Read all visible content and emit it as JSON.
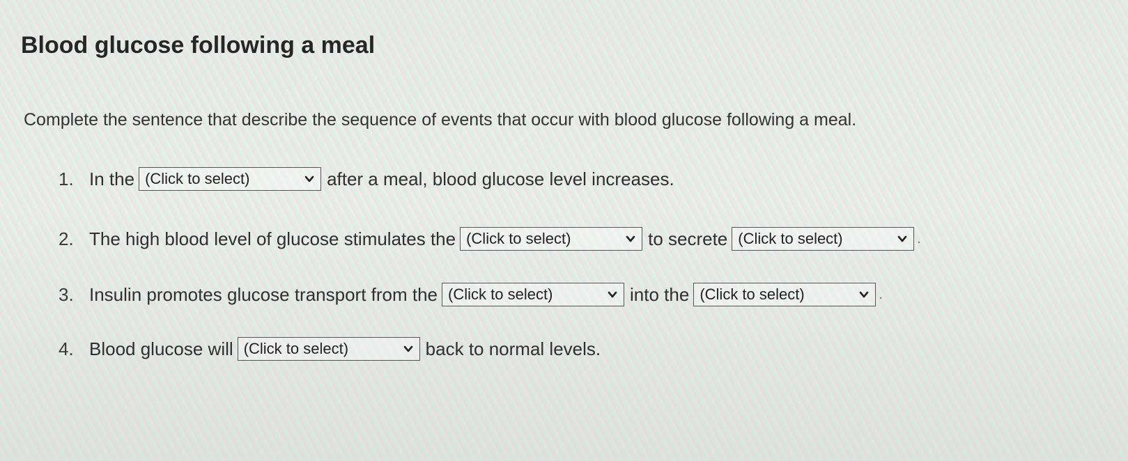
{
  "title": "Blood glucose following a meal",
  "instructions": "Complete the sentence that describe the sequence of events that occur with blood glucose following a meal.",
  "select_placeholder": "(Click to select)",
  "items": [
    {
      "number": "1.",
      "before": "In the",
      "after": "after a meal, blood glucose level increases."
    },
    {
      "number": "2.",
      "before": "The high blood level of glucose stimulates the",
      "middle": "to secrete",
      "end": "."
    },
    {
      "number": "3.",
      "before": "Insulin promotes glucose transport from the",
      "middle": "into the",
      "end": "."
    },
    {
      "number": "4.",
      "before": "Blood glucose will",
      "after": "back to normal levels."
    }
  ]
}
